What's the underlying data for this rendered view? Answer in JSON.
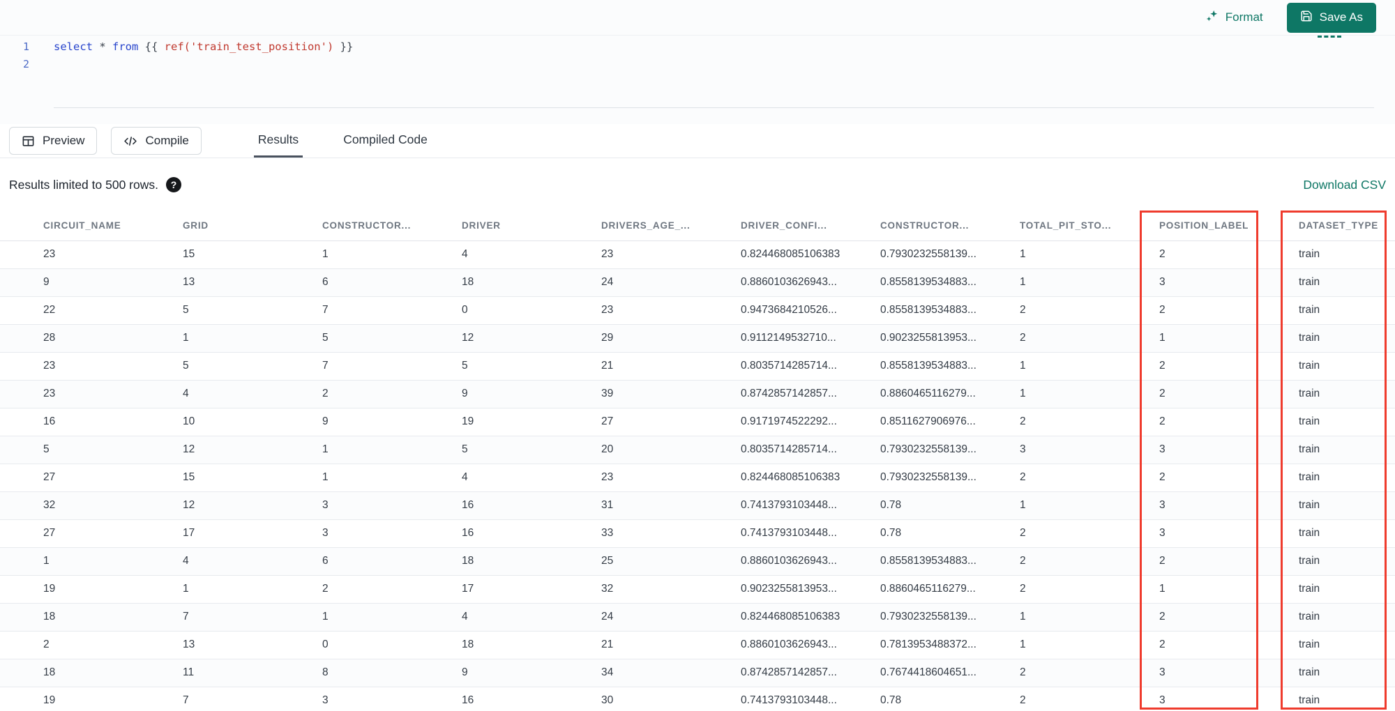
{
  "theme": {
    "accent": "#0e7765",
    "highlight": "#ef3b2d"
  },
  "toolbar": {
    "format_label": "Format",
    "save_as_label": "Save As"
  },
  "editor": {
    "line_numbers": [
      "1",
      "2"
    ],
    "line1": {
      "kw_select": "select",
      "star": " * ",
      "kw_from": "from",
      "jinja_open": " {{ ",
      "ref_call": "ref('train_test_position')",
      "jinja_close": " }}"
    }
  },
  "run_bar": {
    "preview_label": "Preview",
    "compile_label": "Compile",
    "tabs": [
      {
        "label": "Results",
        "active": true
      },
      {
        "label": "Compiled Code",
        "active": false
      }
    ]
  },
  "results_meta": {
    "limit_text": "Results limited to 500 rows.",
    "help_glyph": "?",
    "download_csv_label": "Download CSV"
  },
  "table": {
    "columns": [
      "CIRCUIT_NAME",
      "GRID",
      "CONSTRUCTOR...",
      "DRIVER",
      "DRIVERS_AGE_...",
      "DRIVER_CONFI...",
      "CONSTRUCTOR...",
      "TOTAL_PIT_STO...",
      "POSITION_LABEL",
      "DATASET_TYPE"
    ],
    "rows": [
      [
        "23",
        "15",
        "1",
        "4",
        "23",
        "0.824468085106383",
        "0.7930232558139...",
        "1",
        "2",
        "train"
      ],
      [
        "9",
        "13",
        "6",
        "18",
        "24",
        "0.8860103626943...",
        "0.8558139534883...",
        "1",
        "3",
        "train"
      ],
      [
        "22",
        "5",
        "7",
        "0",
        "23",
        "0.9473684210526...",
        "0.8558139534883...",
        "2",
        "2",
        "train"
      ],
      [
        "28",
        "1",
        "5",
        "12",
        "29",
        "0.9112149532710...",
        "0.9023255813953...",
        "2",
        "1",
        "train"
      ],
      [
        "23",
        "5",
        "7",
        "5",
        "21",
        "0.8035714285714...",
        "0.8558139534883...",
        "1",
        "2",
        "train"
      ],
      [
        "23",
        "4",
        "2",
        "9",
        "39",
        "0.8742857142857...",
        "0.8860465116279...",
        "1",
        "2",
        "train"
      ],
      [
        "16",
        "10",
        "9",
        "19",
        "27",
        "0.9171974522292...",
        "0.8511627906976...",
        "2",
        "2",
        "train"
      ],
      [
        "5",
        "12",
        "1",
        "5",
        "20",
        "0.8035714285714...",
        "0.7930232558139...",
        "3",
        "3",
        "train"
      ],
      [
        "27",
        "15",
        "1",
        "4",
        "23",
        "0.824468085106383",
        "0.7930232558139...",
        "2",
        "2",
        "train"
      ],
      [
        "32",
        "12",
        "3",
        "16",
        "31",
        "0.7413793103448...",
        "0.78",
        "1",
        "3",
        "train"
      ],
      [
        "27",
        "17",
        "3",
        "16",
        "33",
        "0.7413793103448...",
        "0.78",
        "2",
        "3",
        "train"
      ],
      [
        "1",
        "4",
        "6",
        "18",
        "25",
        "0.8860103626943...",
        "0.8558139534883...",
        "2",
        "2",
        "train"
      ],
      [
        "19",
        "1",
        "2",
        "17",
        "32",
        "0.9023255813953...",
        "0.8860465116279...",
        "2",
        "1",
        "train"
      ],
      [
        "18",
        "7",
        "1",
        "4",
        "24",
        "0.824468085106383",
        "0.7930232558139...",
        "1",
        "2",
        "train"
      ],
      [
        "2",
        "13",
        "0",
        "18",
        "21",
        "0.8860103626943...",
        "0.7813953488372...",
        "1",
        "2",
        "train"
      ],
      [
        "18",
        "11",
        "8",
        "9",
        "34",
        "0.8742857142857...",
        "0.7674418604651...",
        "2",
        "3",
        "train"
      ],
      [
        "19",
        "7",
        "3",
        "16",
        "30",
        "0.7413793103448...",
        "0.78",
        "2",
        "3",
        "train"
      ]
    ]
  },
  "annotations": {
    "boxes": [
      {
        "column": "POSITION_LABEL"
      },
      {
        "column": "DATASET_TYPE"
      }
    ]
  }
}
